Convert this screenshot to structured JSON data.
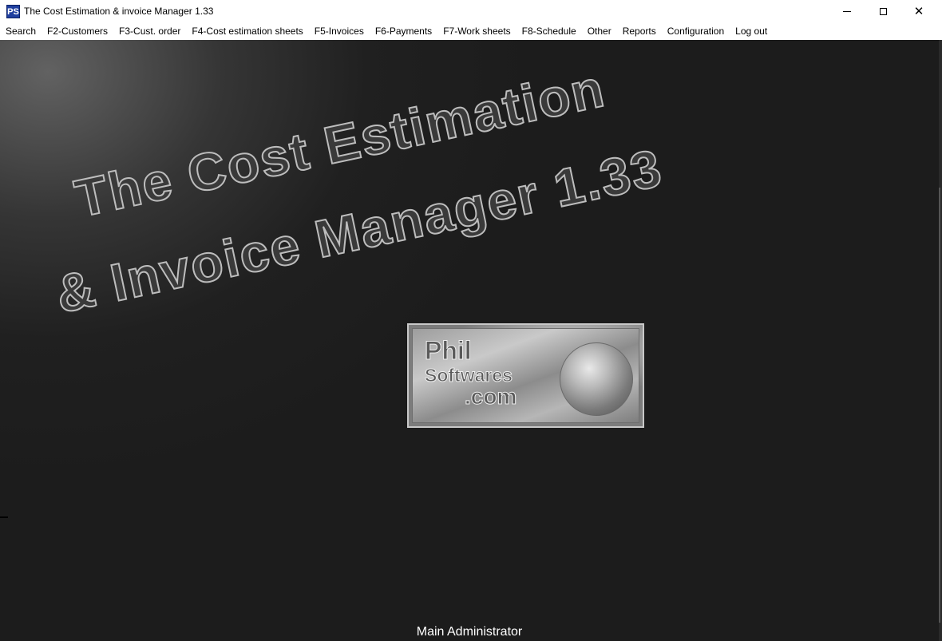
{
  "window": {
    "title": "The Cost Estimation & invoice Manager 1.33",
    "icon_label": "PS",
    "controls": {
      "minimize": "minimize-icon",
      "maximize": "maximize-icon",
      "close": "close-icon"
    }
  },
  "menu": {
    "items": [
      {
        "label": "Search"
      },
      {
        "label": "F2-Customers"
      },
      {
        "label": "F3-Cust. order"
      },
      {
        "label": "F4-Cost estimation sheets"
      },
      {
        "label": "F5-Invoices"
      },
      {
        "label": "F6-Payments"
      },
      {
        "label": "F7-Work sheets"
      },
      {
        "label": "F8-Schedule"
      },
      {
        "label": "Other"
      },
      {
        "label": "Reports"
      },
      {
        "label": "Configuration"
      },
      {
        "label": "Log out"
      }
    ]
  },
  "splash": {
    "line1": "The Cost Estimation",
    "line2": "& Invoice Manager 1.33"
  },
  "logo": {
    "line1": "Phil",
    "line2": "Softwares",
    "line3": ".com"
  },
  "footer": {
    "user": "Main Administrator"
  },
  "colors": {
    "background": "#1c1c1c",
    "title_text_stroke": "#bdbdbd",
    "footer_text": "#ffffff",
    "app_icon": "#1f3f9f"
  }
}
